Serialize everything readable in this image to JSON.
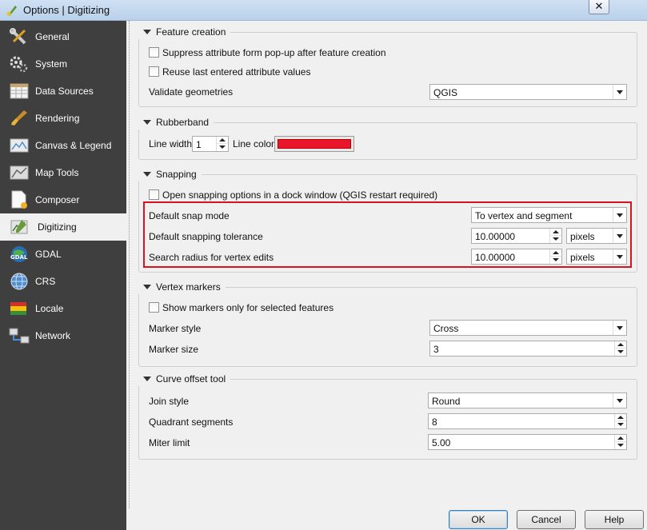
{
  "window": {
    "title": "Options | Digitizing",
    "close_glyph": "✕"
  },
  "sidebar": {
    "items": [
      {
        "label": "General",
        "icon": "tools-icon"
      },
      {
        "label": "System",
        "icon": "gears-icon"
      },
      {
        "label": "Data Sources",
        "icon": "table-icon"
      },
      {
        "label": "Rendering",
        "icon": "paintbrush-icon"
      },
      {
        "label": "Canvas & Legend",
        "icon": "canvas-icon"
      },
      {
        "label": "Map Tools",
        "icon": "map-tools-icon"
      },
      {
        "label": "Composer",
        "icon": "composer-icon"
      },
      {
        "label": "Digitizing",
        "icon": "digitizing-icon",
        "selected": true
      },
      {
        "label": "GDAL",
        "icon": "gdal-icon"
      },
      {
        "label": "CRS",
        "icon": "globe-icon"
      },
      {
        "label": "Locale",
        "icon": "flag-icon"
      },
      {
        "label": "Network",
        "icon": "network-icon"
      }
    ]
  },
  "feature_creation": {
    "title": "Feature creation",
    "suppress_label": "Suppress attribute form pop-up after feature creation",
    "reuse_label": "Reuse last entered attribute values",
    "validate_label": "Validate geometries",
    "validate_value": "QGIS"
  },
  "rubberband": {
    "title": "Rubberband",
    "line_width_label": "Line width",
    "line_width_value": "1",
    "line_color_label": "Line color",
    "line_color": "#e8152b"
  },
  "snapping": {
    "title": "Snapping",
    "dock_label": "Open snapping options in a dock window (QGIS restart required)",
    "mode_label": "Default snap mode",
    "mode_value": "To vertex and segment",
    "tolerance_label": "Default snapping tolerance",
    "tolerance_value": "10.00000",
    "tolerance_unit": "pixels",
    "radius_label": "Search radius for vertex edits",
    "radius_value": "10.00000",
    "radius_unit": "pixels",
    "highlight_color": "#d4141e"
  },
  "vertex_markers": {
    "title": "Vertex markers",
    "selected_only_label": "Show markers only for selected features",
    "style_label": "Marker style",
    "style_value": "Cross",
    "size_label": "Marker size",
    "size_value": "3"
  },
  "curve_offset": {
    "title": "Curve offset tool",
    "join_label": "Join style",
    "join_value": "Round",
    "quadrant_label": "Quadrant segments",
    "quadrant_value": "8",
    "miter_label": "Miter limit",
    "miter_value": "5.00"
  },
  "buttons": {
    "ok": "OK",
    "cancel": "Cancel",
    "help": "Help"
  }
}
